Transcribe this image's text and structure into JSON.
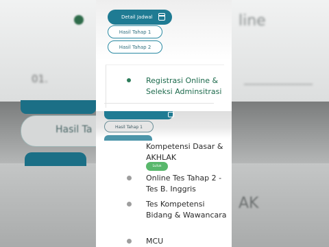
{
  "phone": {
    "buttons": {
      "detail_jadwal": "Detail Jadwal",
      "hasil_tahap_1": "Hasil Tahap 1",
      "hasil_tahap_2": "Hasil Tahap 2"
    },
    "steps": [
      {
        "label": "Registrasi Online & Seleksi Adminsitrasi",
        "state": "active"
      },
      {
        "label": "Kompetensi Dasar & AKHLAK",
        "badge": "Lulus"
      },
      {
        "label": "Online Tes Tahap 2 - Tes B. Inggris",
        "state": "pending"
      },
      {
        "label": "Tes Kompetensi Bidang & Wawancara",
        "state": "pending"
      },
      {
        "label": "MCU",
        "state": "pending"
      }
    ],
    "overlay": {
      "hasil_tahap_1": "Hasil Tahap 1"
    }
  },
  "background": {
    "left_button": "Hasil Ta",
    "right_text_top": "line",
    "right_text_bottom": "AK"
  },
  "colors": {
    "teal": "#1f7b93",
    "green_active": "#1d6a4c",
    "badge_green": "#59b86c"
  },
  "icons": [
    "calendar-icon",
    "bullet-icon"
  ]
}
